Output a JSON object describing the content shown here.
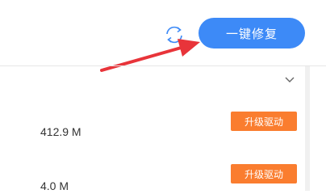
{
  "header": {
    "fix_all_label": "一键修复",
    "refresh_icon": "refresh-icon"
  },
  "list": {
    "expand_icon": "chevron-down-icon",
    "items": [
      {
        "size": "412.9 M",
        "action_label": "升级驱动"
      },
      {
        "size": "4.0 M",
        "action_label": "升级驱动"
      }
    ]
  },
  "colors": {
    "primary_button": "#3d8af7",
    "upgrade_button": "#fa7d2f",
    "annotation_arrow": "#e8343a"
  }
}
